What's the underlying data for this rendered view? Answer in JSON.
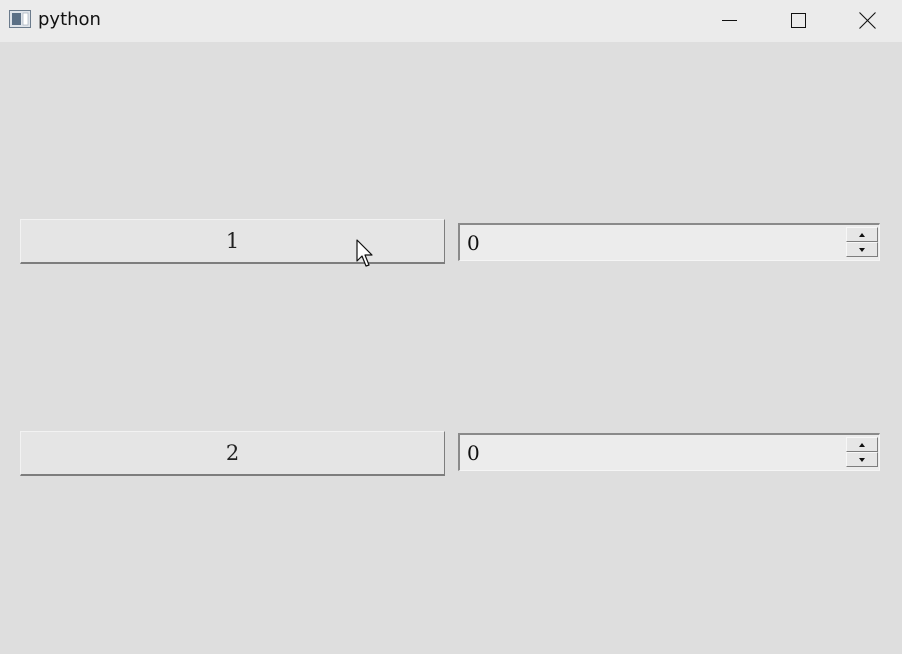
{
  "window": {
    "title": "python",
    "icons": {
      "app": "python-window-icon",
      "minimize": "minimize-icon",
      "maximize": "maximize-icon",
      "close": "close-icon"
    }
  },
  "rows": [
    {
      "button_label": "1",
      "spin_value": "0"
    },
    {
      "button_label": "2",
      "spin_value": "0"
    }
  ],
  "colors": {
    "background": "#dedede",
    "titlebar": "#ebebeb",
    "field": "#ececec"
  }
}
